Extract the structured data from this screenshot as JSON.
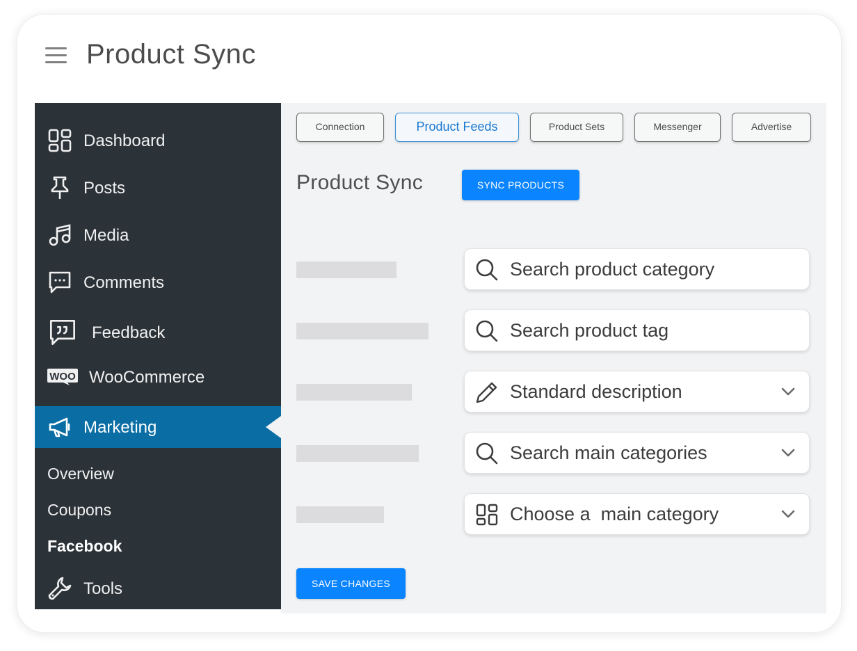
{
  "header": {
    "title": "Product Sync",
    "menu_icon": "hamburger-menu-icon"
  },
  "sidebar": {
    "items": [
      {
        "label": "Dashboard",
        "icon": "dashboard-icon"
      },
      {
        "label": "Posts",
        "icon": "pushpin-icon"
      },
      {
        "label": "Media",
        "icon": "music-note-icon"
      },
      {
        "label": "Comments",
        "icon": "comment-icon"
      },
      {
        "label": "Feedback",
        "icon": "feedback-quote-icon"
      },
      {
        "label": "WooCommerce",
        "icon": "woo-logo-icon"
      },
      {
        "label": "Marketing",
        "icon": "megaphone-icon",
        "active": true
      },
      {
        "label": "Tools",
        "icon": "wrench-icon"
      }
    ],
    "woo_logo_text": "WOO",
    "submenu": [
      {
        "label": "Overview"
      },
      {
        "label": "Coupons"
      },
      {
        "label": "Facebook",
        "current": true
      }
    ]
  },
  "tabs": [
    {
      "label": "Connection"
    },
    {
      "label": "Product Feeds",
      "active": true
    },
    {
      "label": "Product Sets"
    },
    {
      "label": "Messenger"
    },
    {
      "label": "Advertise"
    }
  ],
  "main": {
    "section_title": "Product Sync",
    "sync_button": "SYNC PRODUCTS",
    "save_button": "SAVE CHANGES",
    "fields": [
      {
        "placeholder": "Search product category",
        "icon": "search-icon",
        "dropdown": false
      },
      {
        "placeholder": "Search product tag",
        "icon": "search-icon",
        "dropdown": false
      },
      {
        "placeholder": "Standard description",
        "icon": "pencil-icon",
        "dropdown": true
      },
      {
        "placeholder": "Search main categories",
        "icon": "search-icon",
        "dropdown": true
      },
      {
        "placeholder": "Choose a  main category",
        "icon": "grid-icon",
        "dropdown": true
      }
    ]
  },
  "colors": {
    "sidebar_bg": "#2c3338",
    "active_bg": "#0a6ea5",
    "primary_button": "#0a84ff",
    "main_bg": "#f2f3f5",
    "active_tab_text": "#1877d1"
  }
}
